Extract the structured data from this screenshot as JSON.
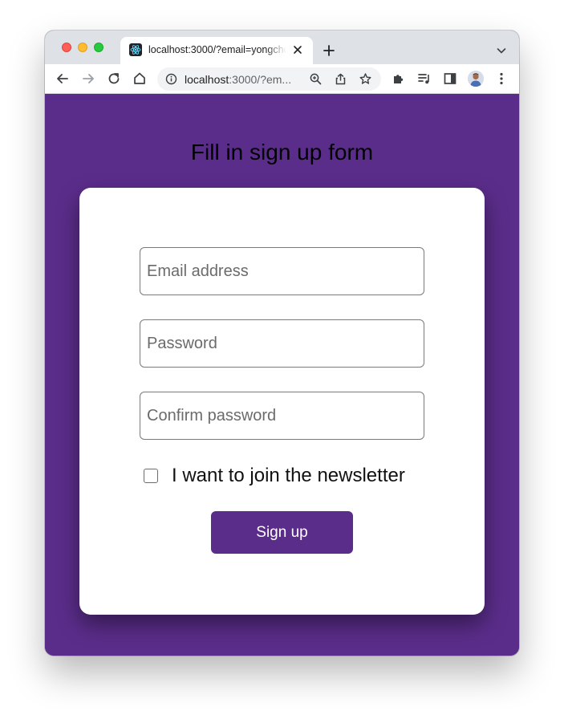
{
  "browser": {
    "tab": {
      "title": "localhost:3000/?email=yongcho",
      "favicon": "react-logo-icon"
    },
    "address_bar": {
      "url_host": "localhost",
      "url_rest": ":3000/?em..."
    },
    "icons": {
      "back": "back-arrow-icon",
      "forward": "forward-arrow-icon",
      "reload": "reload-icon",
      "home": "home-icon",
      "site_info": "info-icon",
      "zoom": "zoom-icon",
      "share": "share-icon",
      "bookmark": "star-icon",
      "extensions": "puzzle-icon",
      "media": "media-queue-icon",
      "side_panel": "side-panel-icon",
      "profile": "avatar",
      "menu": "kebab-menu-icon"
    }
  },
  "page": {
    "heading": "Fill in sign up form",
    "background_color": "#5b2d8b",
    "form": {
      "email_placeholder": "Email address",
      "password_placeholder": "Password",
      "confirm_placeholder": "Confirm password",
      "newsletter_label": "I want to join the newsletter",
      "newsletter_checked": false,
      "submit_label": "Sign up",
      "button_color": "#5b2d8b"
    }
  }
}
